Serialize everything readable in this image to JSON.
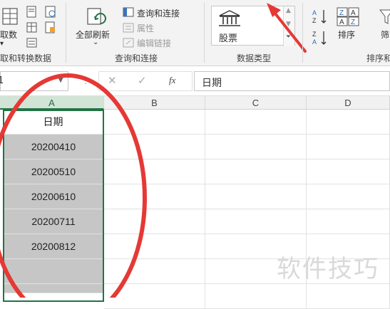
{
  "ribbon": {
    "get_transform": {
      "partial_label": "取数",
      "group_label": "取和转换数据"
    },
    "queries": {
      "refresh_all_label": "全部刷新",
      "queries_connections_label": "查询和连接",
      "properties_label": "属性",
      "edit_links_label": "编辑链接",
      "group_label": "查询和连接"
    },
    "data_types": {
      "stocks_label": "股票",
      "group_label": "数据类型"
    },
    "sort_filter": {
      "sort_label": "排序",
      "filter_partial_label": "筛",
      "group_label": "排序和"
    }
  },
  "formula_bar": {
    "name_box_value": "1",
    "fx_label": "fx",
    "content": "日期"
  },
  "grid": {
    "columns": [
      "A",
      "B",
      "C",
      "D"
    ],
    "header_cell": "日期",
    "cells": [
      "20200410",
      "20200510",
      "20200610",
      "20200711",
      "20200812",
      ""
    ]
  },
  "watermark": "软件技巧",
  "colors": {
    "accent_green": "#217346",
    "annotation_red": "#e53935"
  }
}
